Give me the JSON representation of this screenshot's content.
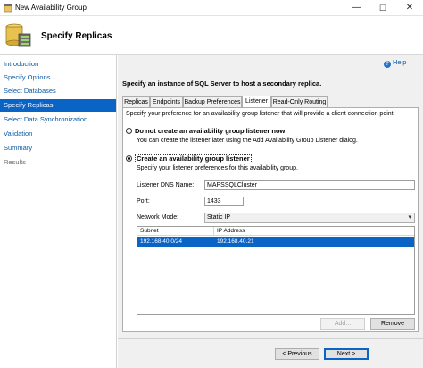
{
  "window": {
    "title": "New Availability Group",
    "controls": {
      "minimize": "—",
      "maximize": "☐",
      "close": "✕"
    }
  },
  "header": {
    "heading": "Specify Replicas"
  },
  "sidebar": {
    "items": [
      {
        "label": "Introduction",
        "state": "link"
      },
      {
        "label": "Specify Options",
        "state": "link"
      },
      {
        "label": "Select Databases",
        "state": "link"
      },
      {
        "label": "Specify Replicas",
        "state": "active"
      },
      {
        "label": "Select Data Synchronization",
        "state": "link"
      },
      {
        "label": "Validation",
        "state": "link"
      },
      {
        "label": "Summary",
        "state": "link"
      },
      {
        "label": "Results",
        "state": "disabled"
      }
    ]
  },
  "main": {
    "help_label": "Help",
    "instruction": "Specify an instance of SQL Server to host a secondary replica.",
    "tabs": [
      {
        "label": "Replicas",
        "selected": false
      },
      {
        "label": "Endpoints",
        "selected": false
      },
      {
        "label": "Backup Preferences",
        "selected": false
      },
      {
        "label": "Listener",
        "selected": true
      },
      {
        "label": "Read-Only Routing",
        "selected": false
      }
    ],
    "listener": {
      "description": "Specify your preference for an availability group listener that will provide a client connection point:",
      "option_none": {
        "label": "Do not create an availability group listener now",
        "subtext": "You can create the listener later using the Add Availability Group Listener dialog.",
        "checked": false
      },
      "option_create": {
        "label": "Create an availability group listener",
        "subtext": "Specify your listener preferences for this availability group.",
        "checked": true
      },
      "dns_label": "Listener DNS Name:",
      "dns_value": "MAPSSQLCluster",
      "port_label": "Port:",
      "port_value": "1433",
      "mode_label": "Network Mode:",
      "mode_value": "Static IP",
      "grid": {
        "columns": [
          "Subnet",
          "IP Address"
        ],
        "rows": [
          {
            "subnet": "192.168.40.0/24",
            "ip": "192.168.40.21"
          }
        ]
      },
      "add_label": "Add...",
      "remove_label": "Remove"
    },
    "footer": {
      "previous_label": "< Previous",
      "next_label": "Next >"
    }
  },
  "colors": {
    "accent": "#0a64c6",
    "link": "#0c5aa6",
    "panel_bg": "#f0f0f0"
  }
}
